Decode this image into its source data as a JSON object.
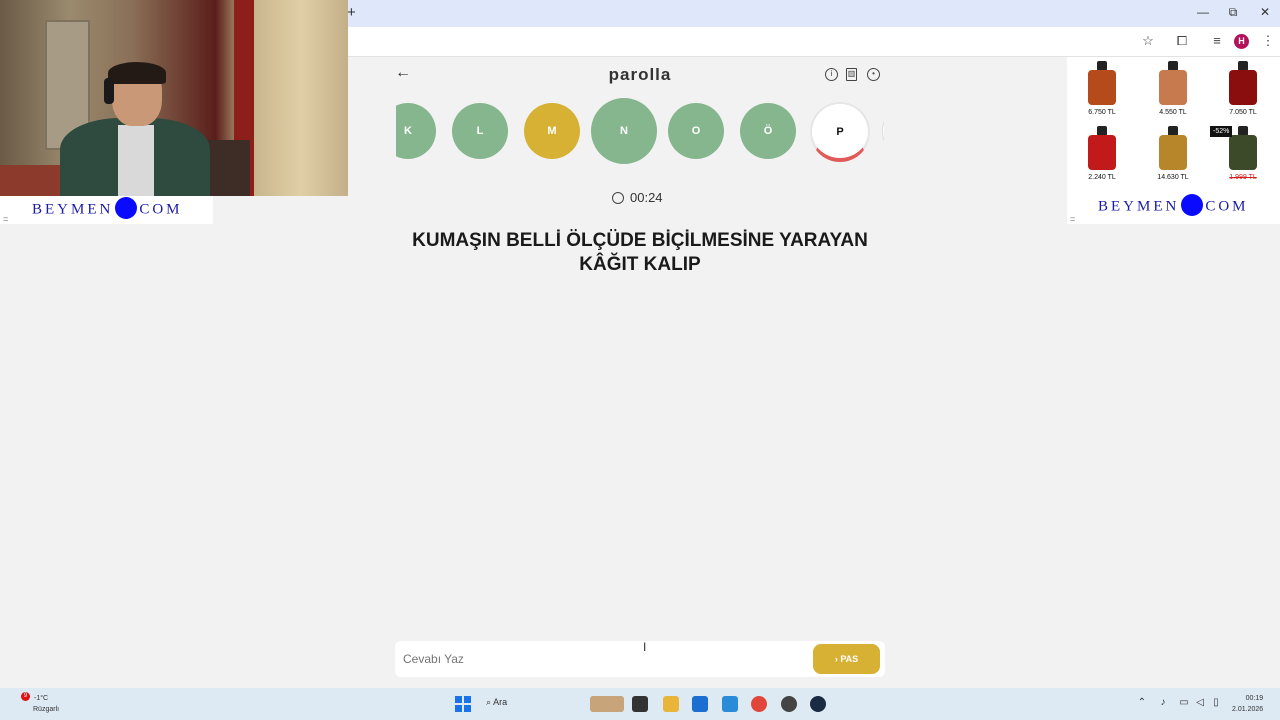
{
  "browser": {
    "newtab_label": "+",
    "window_controls": {
      "minimize": "—",
      "maximize": "⧉",
      "close": "✕"
    },
    "profile_initial": "H",
    "toolbar_icons": [
      "star-icon",
      "extensions-icon",
      "reading-list-icon",
      "menu-icon"
    ]
  },
  "game": {
    "title": "parolla",
    "letters": [
      {
        "char": "K",
        "state": "answered",
        "color": "#86b68e"
      },
      {
        "char": "L",
        "state": "answered",
        "color": "#86b68e"
      },
      {
        "char": "M",
        "state": "passed",
        "color": "#d6b134"
      },
      {
        "char": "N",
        "state": "answered",
        "color": "#86b68e"
      },
      {
        "char": "O",
        "state": "answered",
        "color": "#86b68e"
      },
      {
        "char": "Ö",
        "state": "answered",
        "color": "#86b68e"
      },
      {
        "char": "P",
        "state": "current",
        "color": "#ffffff"
      }
    ],
    "timer": "00:24",
    "question": "KUMAŞIN BELLİ ÖLÇÜDE BİÇİLMESİNE YARAYAN KÂĞIT KALIP",
    "answer_placeholder": "Cevabı Yaz",
    "answer_value": "",
    "pass_label": "PAS",
    "pass_icon": "›",
    "colors": {
      "correct": "#86b68e",
      "passed": "#d6b134",
      "current_ring": "#e05a5a"
    }
  },
  "ads": {
    "brand_left": "BEYMEN",
    "brand_right_suffix": "COM",
    "products": [
      {
        "price": "6.750 TL",
        "color": "#b54a1a"
      },
      {
        "price": "4.550 TL",
        "color": "#c77a4e"
      },
      {
        "price": "7.050 TL",
        "color": "#8a0e0e"
      },
      {
        "price": "2.240 TL",
        "color": "#c21a1a"
      },
      {
        "price": "14.630 TL",
        "color": "#b8862a"
      },
      {
        "price": "1.999 TL",
        "color": "#3c4a2a",
        "discount": "-52%",
        "strikethrough": true
      }
    ]
  },
  "taskbar": {
    "weather_temp": "-1°C",
    "weather_desc": "Rüzgarlı",
    "weather_badge": "9",
    "search_label": "Ara",
    "time": "00:19",
    "date": "2.01.2026"
  }
}
